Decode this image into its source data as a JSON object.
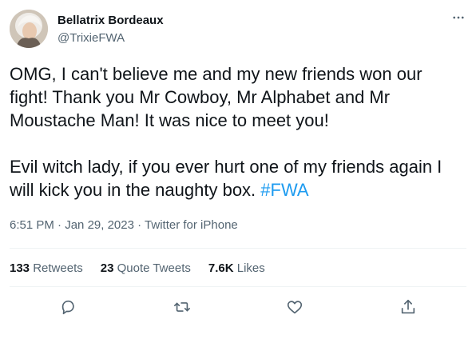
{
  "tweet": {
    "author_name": "Bellatrix Bordeaux",
    "author_handle": "@TrixieFWA",
    "text_main": "OMG, I can't believe me and my new friends won our fight! Thank you Mr Cowboy, Mr Alphabet and Mr Moustache Man! It was nice to meet you!\n\nEvil witch lady, if you ever hurt one of my friends again I will kick you in the naughty box. ",
    "hashtag": "#FWA",
    "time": "6:51 PM",
    "date": "Jan 29, 2023",
    "source": "Twitter for iPhone",
    "separator": "·"
  },
  "stats": {
    "retweets_count": "133",
    "retweets_label": "Retweets",
    "quotes_count": "23",
    "quotes_label": "Quote Tweets",
    "likes_count": "7.6K",
    "likes_label": "Likes"
  },
  "icons": {
    "more": "more-horizontal-icon",
    "reply": "reply-icon",
    "retweet": "retweet-icon",
    "like": "heart-icon",
    "share": "share-icon"
  },
  "colors": {
    "text": "#0f1419",
    "muted": "#536471",
    "accent": "#1d9bf0",
    "divider": "#eff3f4"
  }
}
